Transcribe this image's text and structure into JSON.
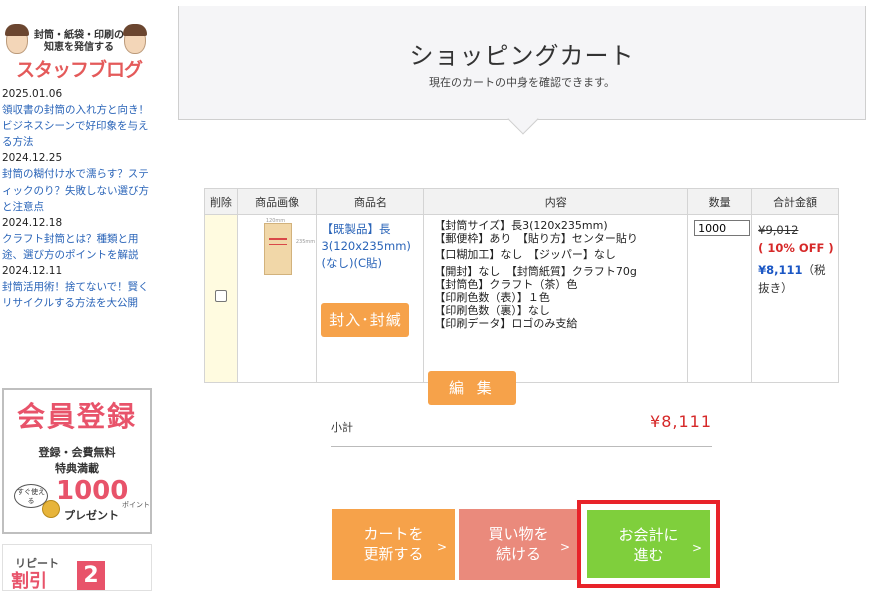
{
  "sidebar": {
    "blog": {
      "bubble_text": "封筒・紙袋・印刷の知恵を発信する",
      "title": "スタッフブログ"
    },
    "news": [
      {
        "date": "2025.01.06",
        "title": "領収書の封筒の入れ方と向き！ビジネスシーンで好印象を与える方法"
      },
      {
        "date": "2024.12.25",
        "title": "封筒の糊付け水で濡らす？スティックのり？失敗しない選び方と注意点"
      },
      {
        "date": "2024.12.18",
        "title": "クラフト封筒とは？種類と用途、選び方のポイントを解説"
      },
      {
        "date": "2024.12.11",
        "title": "封筒活用術！捨てないで！賢くリサイクルする方法を大公開"
      }
    ],
    "member_banner": {
      "title": "会員登録",
      "line1": "登録・会費無料",
      "line2": "特典満載",
      "note": "すぐ使える",
      "points": "1000",
      "points_word": "ポイント",
      "present": "プレゼント"
    },
    "repeat_banner": {
      "line1": "リピート",
      "line2": "割引",
      "num": "2"
    }
  },
  "header": {
    "title": "ショッピングカート",
    "subtitle": "現在のカートの中身を確認できます。"
  },
  "table": {
    "headers": [
      "削除",
      "商品画像",
      "商品名",
      "内容",
      "数量",
      "合計金額"
    ],
    "item": {
      "image_dim_h": "120mm",
      "image_dim_v": "235mm",
      "name": "【既製品】長3(120x235mm)(なし)(C貼)",
      "seal_button": "封入･封緘",
      "specs": [
        "【封筒サイズ】長3(120x235mm)",
        "【郵便枠】あり　【貼り方】センター貼り",
        "【口糊加工】なし　【ジッパー】なし",
        "【開封】なし　【封筒紙質】クラフト70g",
        "【封筒色】クラフト（茶）色",
        "【印刷色数（表）】１色",
        "【印刷色数（裏）】なし",
        "【印刷データ】ロゴのみ支給"
      ],
      "edit_button": "編 集",
      "quantity": "1000",
      "original_price": "¥9,012",
      "discount": "( 10% OFF )",
      "final_price": "¥8,111",
      "tax_note": "（税抜き）"
    }
  },
  "subtotal": {
    "label": "小計",
    "value": "¥8,111"
  },
  "actions": {
    "update": "カートを\n更新する",
    "continue": "買い物を\n続ける",
    "checkout": "お会計に\n進む",
    "arrow": ">"
  }
}
